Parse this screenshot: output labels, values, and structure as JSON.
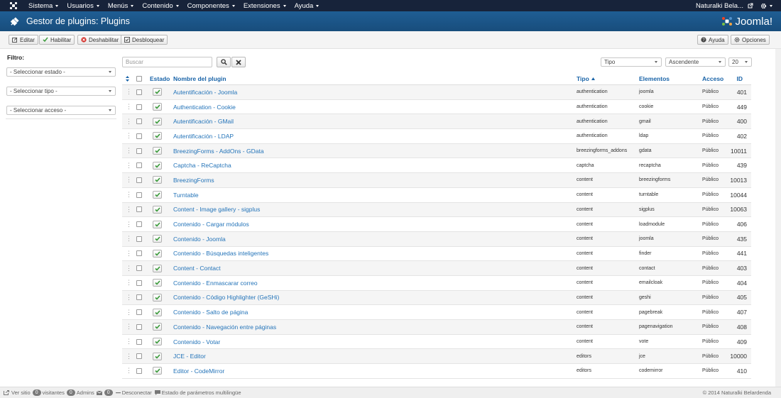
{
  "navbar": {
    "menus": [
      "Sistema",
      "Usuarios",
      "Menús",
      "Contenido",
      "Componentes",
      "Extensiones",
      "Ayuda"
    ],
    "user": "Naturalki Bela..."
  },
  "header": {
    "title": "Gestor de plugins: Plugins",
    "brand": "Joomla!"
  },
  "toolbar": {
    "edit": "Editar",
    "enable": "Habilitar",
    "disable": "Deshabilitar",
    "unlock": "Desbloquear",
    "help": "Ayuda",
    "options": "Opciones"
  },
  "sidebar": {
    "filter_label": "Filtro:",
    "state_select": "- Seleccionar estado -",
    "type_select": "- Seleccionar tipo -",
    "access_select": "- Seleccionar acceso -"
  },
  "search": {
    "placeholder": "Buscar"
  },
  "sorting": {
    "field": "Tipo",
    "direction": "Ascendente",
    "limit": "20"
  },
  "table": {
    "headers": {
      "status": "Estado",
      "name": "Nombre del plugin",
      "type": "Tipo",
      "elements": "Elementos",
      "access": "Acceso",
      "id": "ID"
    },
    "rows": [
      {
        "name": "Autentificación - Joomla",
        "type": "authentication",
        "element": "joomla",
        "access": "Público",
        "id": "401"
      },
      {
        "name": "Authentication - Cookie",
        "type": "authentication",
        "element": "cookie",
        "access": "Público",
        "id": "449"
      },
      {
        "name": "Autentificación - GMail",
        "type": "authentication",
        "element": "gmail",
        "access": "Público",
        "id": "400"
      },
      {
        "name": "Autentificación - LDAP",
        "type": "authentication",
        "element": "ldap",
        "access": "Público",
        "id": "402"
      },
      {
        "name": "BreezingForms - AddOns - GData",
        "type": "breezingforms_addons",
        "element": "gdata",
        "access": "Público",
        "id": "10011"
      },
      {
        "name": "Captcha - ReCaptcha",
        "type": "captcha",
        "element": "recaptcha",
        "access": "Público",
        "id": "439"
      },
      {
        "name": "BreezingForms",
        "type": "content",
        "element": "breezingforms",
        "access": "Público",
        "id": "10013"
      },
      {
        "name": "Turntable",
        "type": "content",
        "element": "turntable",
        "access": "Público",
        "id": "10044"
      },
      {
        "name": "Content - Image gallery - sigplus",
        "type": "content",
        "element": "sigplus",
        "access": "Público",
        "id": "10063"
      },
      {
        "name": "Contenido - Cargar módulos",
        "type": "content",
        "element": "loadmodule",
        "access": "Público",
        "id": "406"
      },
      {
        "name": "Contenido - Joomla",
        "type": "content",
        "element": "joomla",
        "access": "Público",
        "id": "435"
      },
      {
        "name": "Contenido - Búsquedas inteligentes",
        "type": "content",
        "element": "finder",
        "access": "Público",
        "id": "441"
      },
      {
        "name": "Content - Contact",
        "type": "content",
        "element": "contact",
        "access": "Público",
        "id": "403"
      },
      {
        "name": "Contenido - Enmascarar correo",
        "type": "content",
        "element": "emailcloak",
        "access": "Público",
        "id": "404"
      },
      {
        "name": "Contenido - Código Highlighter (GeSHi)",
        "type": "content",
        "element": "geshi",
        "access": "Público",
        "id": "405"
      },
      {
        "name": "Contenido - Salto de página",
        "type": "content",
        "element": "pagebreak",
        "access": "Público",
        "id": "407"
      },
      {
        "name": "Contenido - Navegación entre páginas",
        "type": "content",
        "element": "pagenavigation",
        "access": "Público",
        "id": "408"
      },
      {
        "name": "Contenido - Votar",
        "type": "content",
        "element": "vote",
        "access": "Público",
        "id": "409"
      },
      {
        "name": "JCE - Editor",
        "type": "editors",
        "element": "jce",
        "access": "Público",
        "id": "10000"
      },
      {
        "name": "Editor - CodeMirror",
        "type": "editors",
        "element": "codemirror",
        "access": "Público",
        "id": "410"
      }
    ]
  },
  "footer": {
    "view_site": "Ver sitio",
    "visitors_count": "0",
    "visitors_label": "visitantes",
    "admins_count": "0",
    "admins_label": "Admins",
    "messages_count": "0",
    "logout": "Desconectar",
    "multilang": "Estado de parámetros multilingüe",
    "copyright": "© 2014 Naturalki Belardenda"
  },
  "colors": {
    "navbar": "#17233a",
    "titlebar": "#1c5689",
    "link": "#2474b9",
    "check": "#3a9a3a"
  }
}
